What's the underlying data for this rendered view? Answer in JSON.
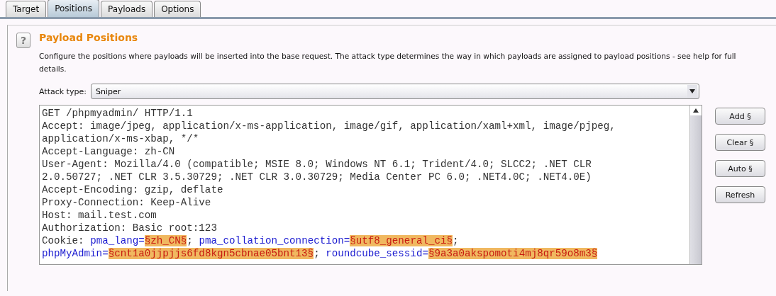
{
  "tabs": [
    {
      "label": "Target",
      "selected": false
    },
    {
      "label": "Positions",
      "selected": true
    },
    {
      "label": "Payloads",
      "selected": false
    },
    {
      "label": "Options",
      "selected": false
    }
  ],
  "section": {
    "help_icon": "?",
    "title": "Payload Positions",
    "description": "Configure the positions where payloads will be inserted into the base request. The attack type determines the way in which payloads are assigned to payload positions - see help for full details."
  },
  "attack_type": {
    "label": "Attack type:",
    "value": "Sniper"
  },
  "request_lines": [
    [
      {
        "kind": "plain",
        "text": "GET /phpmyadmin/ HTTP/1.1"
      }
    ],
    [
      {
        "kind": "plain",
        "text": "Accept: image/jpeg, application/x-ms-application, image/gif, application/xaml+xml, image/pjpeg,"
      }
    ],
    [
      {
        "kind": "plain",
        "text": "application/x-ms-xbap, */*"
      }
    ],
    [
      {
        "kind": "plain",
        "text": "Accept-Language: zh-CN"
      }
    ],
    [
      {
        "kind": "plain",
        "text": "User-Agent: Mozilla/4.0 (compatible; MSIE 8.0; Windows NT 6.1; Trident/4.0; SLCC2; .NET CLR"
      }
    ],
    [
      {
        "kind": "plain",
        "text": "2.0.50727; .NET CLR 3.5.30729; .NET CLR 3.0.30729; Media Center PC 6.0; .NET4.0C; .NET4.0E)"
      }
    ],
    [
      {
        "kind": "plain",
        "text": "Accept-Encoding: gzip, deflate"
      }
    ],
    [
      {
        "kind": "plain",
        "text": "Proxy-Connection: Keep-Alive"
      }
    ],
    [
      {
        "kind": "plain",
        "text": "Host: mail.test.com"
      }
    ],
    [
      {
        "kind": "plain",
        "text": "Authorization: Basic root:123"
      }
    ],
    [
      {
        "kind": "plain",
        "text": "Cookie: "
      },
      {
        "kind": "param",
        "text": "pma_lang="
      },
      {
        "kind": "payload",
        "text": "§zh_CN§"
      },
      {
        "kind": "plain",
        "text": "; "
      },
      {
        "kind": "param",
        "text": "pma_collation_connection="
      },
      {
        "kind": "payload",
        "text": "§utf8_general_ci§"
      },
      {
        "kind": "plain",
        "text": ";"
      }
    ],
    [
      {
        "kind": "param",
        "text": "phpMyAdmin="
      },
      {
        "kind": "payload",
        "text": "§cnt1a0jjpjjs6fd8kgn5cbnae05bnt13§"
      },
      {
        "kind": "plain",
        "text": "; "
      },
      {
        "kind": "param",
        "text": "roundcube_sessid="
      },
      {
        "kind": "payload",
        "text": "§9a3a0akspomoti4mj8qr59o8m3§"
      }
    ]
  ],
  "buttons": [
    "Add §",
    "Clear §",
    "Auto §",
    "Refresh"
  ]
}
